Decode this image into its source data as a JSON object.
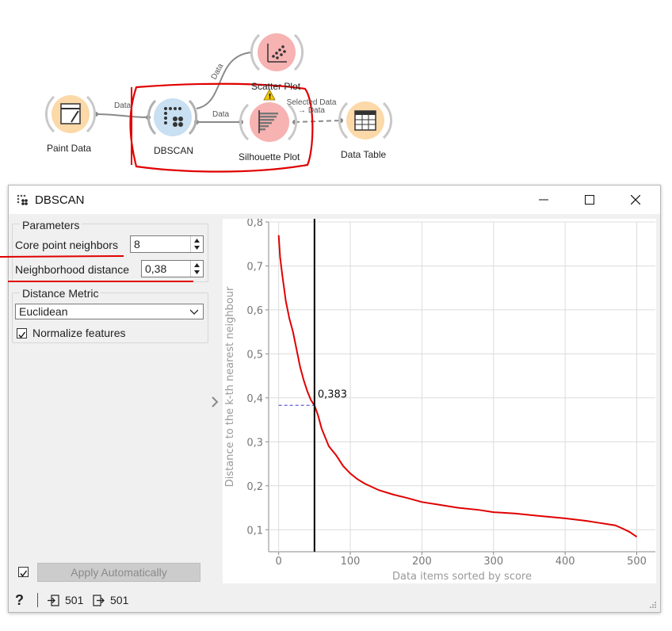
{
  "workflow": {
    "nodes": [
      {
        "id": "paint-data",
        "label": "Paint Data"
      },
      {
        "id": "dbscan",
        "label": "DBSCAN"
      },
      {
        "id": "scatter-plot",
        "label": "Scatter Plot"
      },
      {
        "id": "silhouette-plot",
        "label": "Silhouette Plot"
      },
      {
        "id": "data-table",
        "label": "Data Table"
      }
    ],
    "links": {
      "paint_to_dbscan": "Data",
      "dbscan_to_scatter": "Data",
      "dbscan_to_silhouette": "Data",
      "silhouette_to_table": "Selected Data → Data"
    }
  },
  "window": {
    "title": "DBSCAN",
    "controls": {
      "minimize": "—",
      "maximize": "☐",
      "close": "✕"
    }
  },
  "parameters": {
    "group_title": "Parameters",
    "core_label": "Core point neighbors",
    "core_value": "8",
    "distance_label": "Neighborhood distance",
    "distance_value": "0,38"
  },
  "distance_metric": {
    "group_title": "Distance Metric",
    "selected": "Euclidean",
    "normalize_label": "Normalize features",
    "normalize_checked": true
  },
  "footer": {
    "apply_label": "Apply Automatically",
    "apply_checked": true,
    "help_icon": "?",
    "input_count": "501",
    "output_count": "501"
  },
  "chart_data": {
    "type": "line",
    "xlabel": "Data items sorted by score",
    "ylabel": "Distance to the k-th nearest neighbour",
    "xlim": [
      -14,
      526
    ],
    "ylim": [
      0.05,
      0.8
    ],
    "xticks": [
      0,
      100,
      200,
      300,
      400,
      500
    ],
    "yticks": [
      0.1,
      0.2,
      0.3,
      0.4,
      0.5,
      0.6,
      0.7,
      0.8
    ],
    "xtick_labels": [
      "0",
      "100",
      "200",
      "300",
      "400",
      "500"
    ],
    "ytick_labels": [
      "0,1",
      "0,2",
      "0,3",
      "0,4",
      "0,5",
      "0,6",
      "0,7",
      "0,8"
    ],
    "grid": true,
    "series": [
      {
        "color": "#e00000",
        "x": [
          0,
          2,
          5,
          10,
          15,
          20,
          25,
          30,
          35,
          40,
          45,
          50,
          55,
          60,
          65,
          70,
          80,
          90,
          100,
          110,
          120,
          140,
          160,
          180,
          200,
          220,
          250,
          280,
          300,
          330,
          360,
          400,
          430,
          450,
          470,
          480,
          490,
          500
        ],
        "y": [
          0.77,
          0.72,
          0.68,
          0.62,
          0.58,
          0.55,
          0.51,
          0.47,
          0.44,
          0.415,
          0.395,
          0.383,
          0.36,
          0.33,
          0.31,
          0.29,
          0.27,
          0.245,
          0.228,
          0.215,
          0.205,
          0.19,
          0.18,
          0.172,
          0.163,
          0.158,
          0.15,
          0.145,
          0.14,
          0.137,
          0.132,
          0.126,
          0.12,
          0.115,
          0.11,
          0.103,
          0.095,
          0.084
        ]
      }
    ],
    "cutoff_x": 50,
    "cutoff_y": 0.383,
    "cutoff_label": "0,383",
    "cutoff_line_color": "#000000",
    "cutoff_dash_color": "#3a3ac8"
  }
}
